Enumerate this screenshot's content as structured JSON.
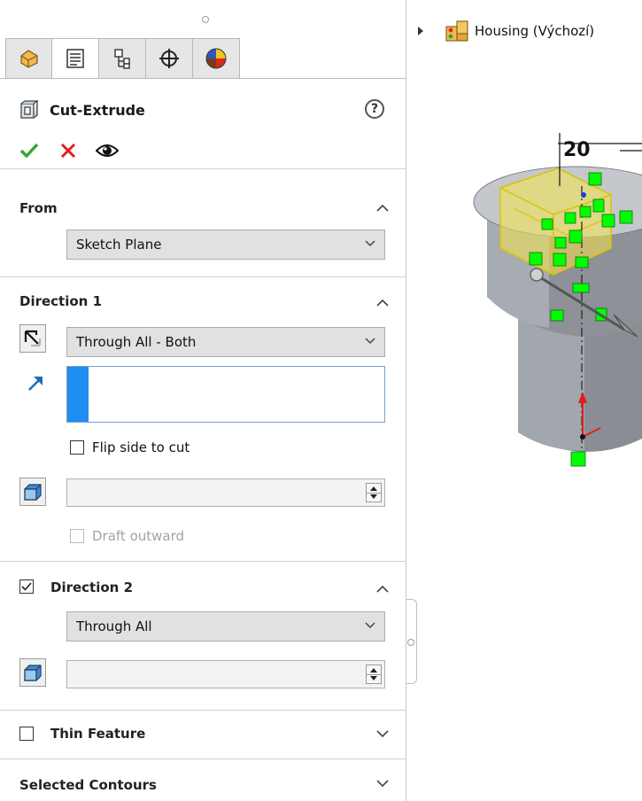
{
  "panel": {
    "tabs": [
      {
        "icon": "feature-manager-icon",
        "active": false
      },
      {
        "icon": "property-manager-icon",
        "active": true
      },
      {
        "icon": "configuration-manager-icon",
        "active": false
      },
      {
        "icon": "dimxpert-manager-icon",
        "active": false
      },
      {
        "icon": "display-manager-icon",
        "active": false
      }
    ],
    "feature_title": "Cut-Extrude",
    "help_icon": "?",
    "actions": {
      "ok": "ok-checkmark-icon",
      "cancel": "cancel-x-icon",
      "preview": "preview-eye-icon"
    },
    "from": {
      "heading": "From",
      "value": "Sketch Plane"
    },
    "direction1": {
      "heading": "Direction 1",
      "end_condition": "Through All - Both",
      "flip_label": "Flip side to cut",
      "flip_checked": false,
      "draft_label": "Draft outward",
      "draft_checked": false,
      "draft_value": ""
    },
    "direction2": {
      "heading": "Direction 2",
      "checked": true,
      "end_condition": "Through All",
      "draft_value": ""
    },
    "thin_feature": {
      "heading": "Thin Feature",
      "checked": false
    },
    "selected_contours": {
      "heading": "Selected Contours"
    }
  },
  "graphics": {
    "tree_item": "Housing  (Výchozí)",
    "dimension_label": "20"
  },
  "colors": {
    "ok_green": "#3aa535",
    "cancel_red": "#e02020",
    "selection_blue": "#1e8ef0",
    "sketch_green": "#00ff00",
    "preview_yellow": "#f5e64a",
    "body_gray": "#8a8d94"
  }
}
